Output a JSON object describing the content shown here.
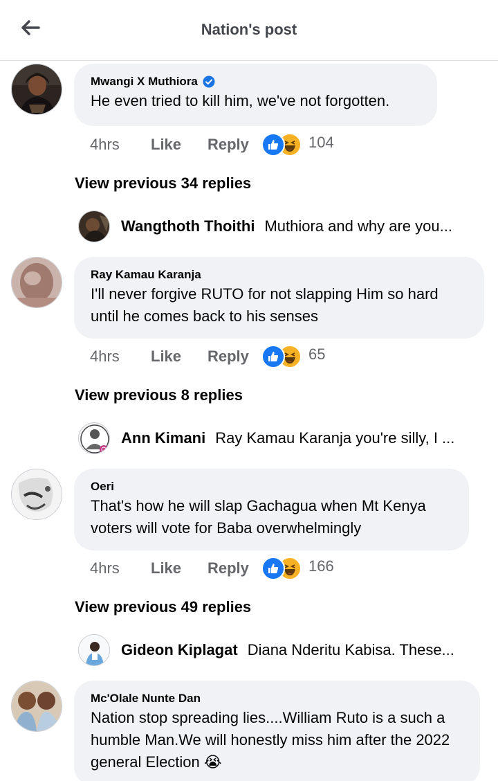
{
  "header": {
    "title": "Nation's post",
    "back_icon": "arrow-left-icon"
  },
  "colors": {
    "bubble": "#f0f2f5",
    "meta_text": "#65676b",
    "verified_blue": "#1b74e4",
    "like_blue": "#1877f2",
    "haha_yellow": "#f7b125"
  },
  "comments": [
    {
      "author": "Mwangi X Muthiora",
      "verified": true,
      "text": "He even tried to kill him, we've not forgotten.",
      "time": "4hrs",
      "like": "Like",
      "reply": "Reply",
      "reaction_count": "104",
      "view_previous": "View previous 34 replies",
      "latest_reply": {
        "author": "Wangthoth Thoithi",
        "text": "Muthiora and why are you..."
      }
    },
    {
      "author": "Ray Kamau Karanja",
      "verified": false,
      "text": "I'll never forgive RUTO for not slapping Him so hard until he comes back to his senses",
      "time": "4hrs",
      "like": "Like",
      "reply": "Reply",
      "reaction_count": "65",
      "view_previous": "View previous 8 replies",
      "latest_reply": {
        "author": "Ann Kimani",
        "text": "Ray Kamau Karanja you're silly, I ..."
      }
    },
    {
      "author": "Oeri",
      "verified": false,
      "text": "That's how he will slap Gachagua when Mt Kenya voters will vote for Baba overwhelmingly",
      "time": "4hrs",
      "like": "Like",
      "reply": "Reply",
      "reaction_count": "166",
      "view_previous": "View previous 49 replies",
      "latest_reply": {
        "author": "Gideon Kiplagat",
        "text": "Diana Nderitu Kabisa. These..."
      }
    },
    {
      "author": "Mc'Olale Nunte Dan",
      "verified": false,
      "text": "Nation stop spreading lies....William Ruto is a such a humble Man.We will honestly miss him after the 2022 general Election",
      "emoji": "😭"
    }
  ]
}
